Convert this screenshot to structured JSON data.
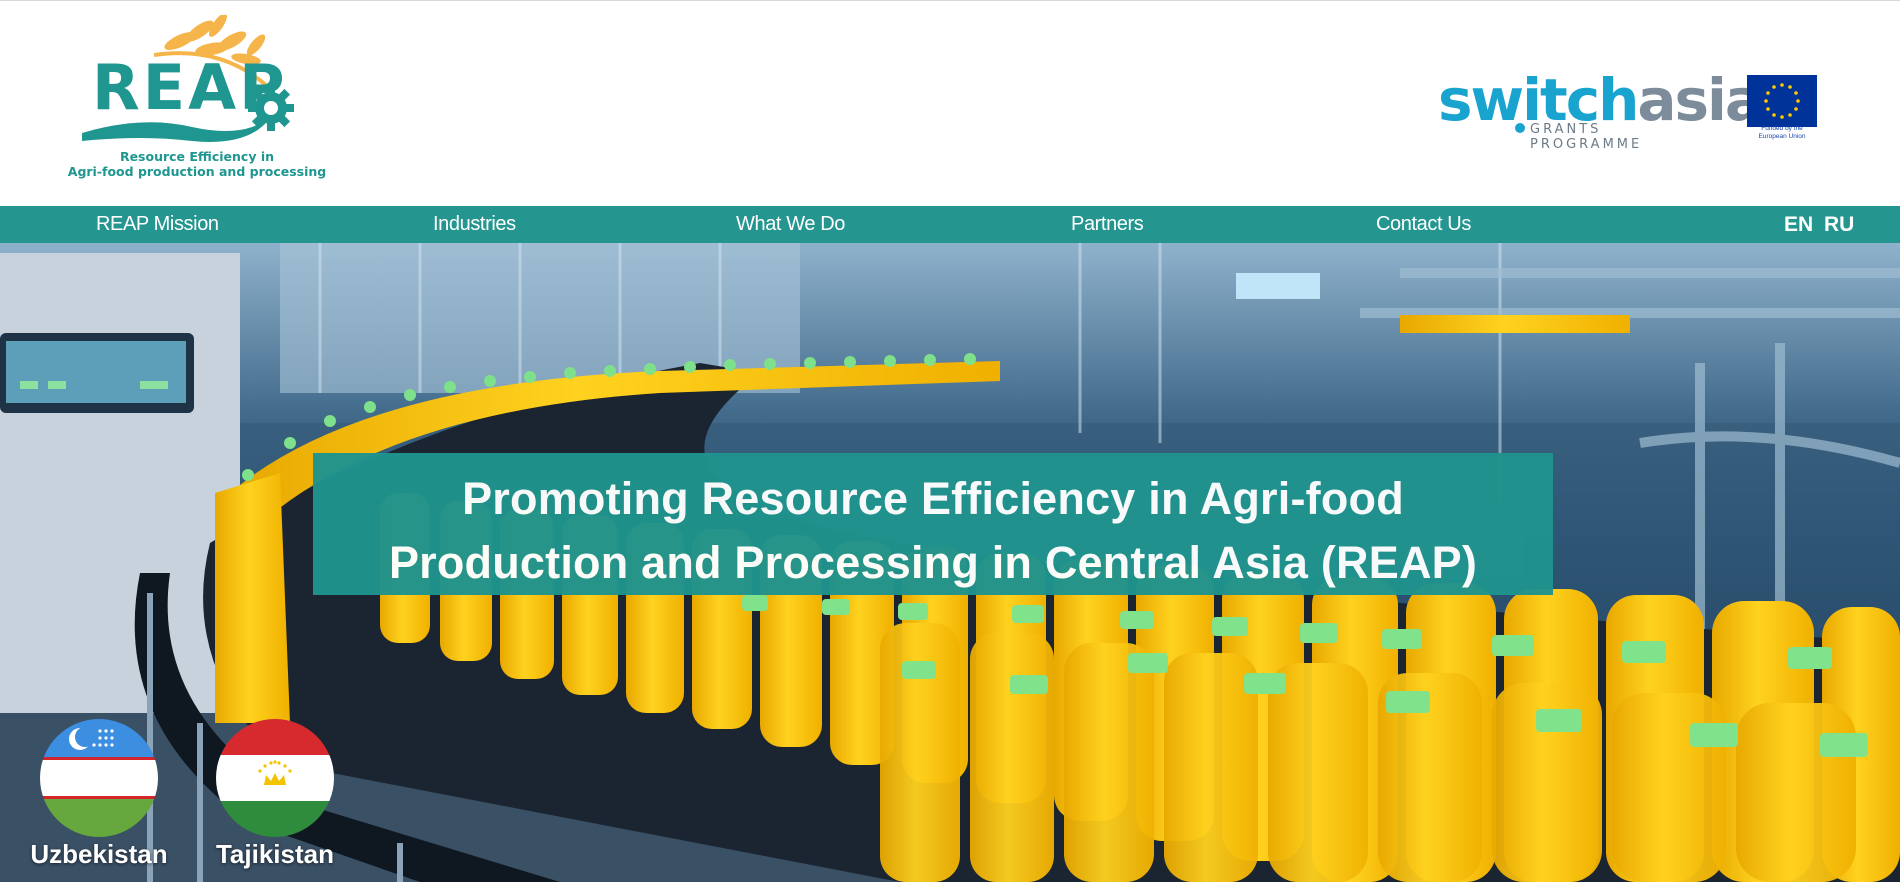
{
  "header": {
    "logo_text": "REAP",
    "logo_tagline_line1": "Resource Efficiency in",
    "logo_tagline_line2": "Agri-food production and processing",
    "switch_asia": {
      "part1": "switch",
      "part2": "asia",
      "subtitle": "GRANTS PROGRAMME"
    },
    "eu_caption": "Funded by the European Union"
  },
  "nav": {
    "items": [
      {
        "label": "REAP Mission"
      },
      {
        "label": "Industries"
      },
      {
        "label": "What We Do"
      },
      {
        "label": "Partners"
      },
      {
        "label": "Contact Us"
      }
    ],
    "languages": [
      "EN",
      "RU"
    ]
  },
  "hero": {
    "title_line1": "Promoting Resource Efficiency in Agri-food",
    "title_line2": "Production and Processing in Central Asia (REAP)",
    "countries": [
      {
        "label": "Uzbekistan"
      },
      {
        "label": "Tajikistan"
      }
    ]
  },
  "colors": {
    "brand_teal": "#24958f",
    "switch_blue": "#19a3cf",
    "eu_blue": "#003399",
    "juice_yellow": "#ffc400",
    "cap_green": "#7ee08a"
  },
  "icons": [
    "wheat-icon",
    "gear-icon",
    "eu-stars-icon",
    "uzbekistan-flag-icon",
    "tajikistan-flag-icon"
  ]
}
